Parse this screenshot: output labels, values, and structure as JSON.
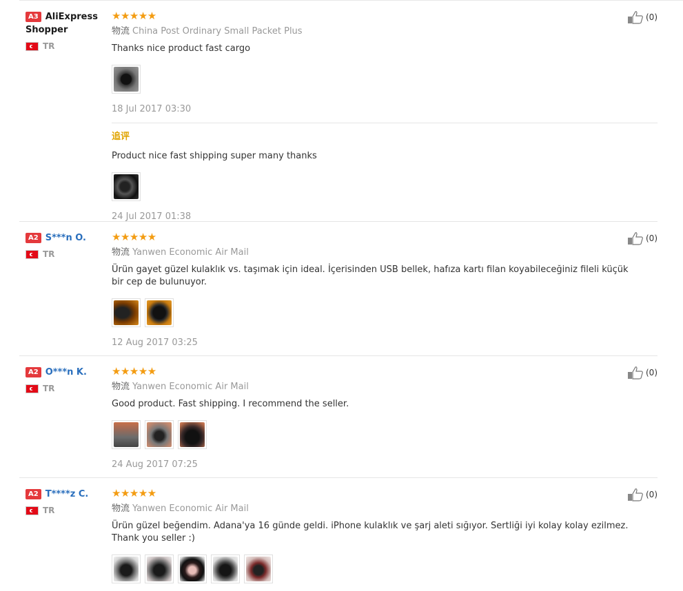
{
  "reviews": [
    {
      "level": "A3",
      "name": "AliExpress Shopper",
      "country": "TR",
      "stars": "★★★★★",
      "logistics_label": "物流",
      "logistics": "China Post Ordinary Small Packet Plus",
      "text": "Thanks nice product fast cargo",
      "date": "18 Jul 2017 03:30",
      "helpful": "(0)",
      "append_title": "追评",
      "append_text": "Product nice fast shipping super many thanks",
      "append_date": "24 Jul 2017 01:38"
    },
    {
      "level": "A2",
      "name": "S***n O.",
      "country": "TR",
      "stars": "★★★★★",
      "logistics_label": "物流",
      "logistics": "Yanwen Economic Air Mail",
      "text": "Ürün gayet güzel kulaklık vs. taşımak için ideal. İçerisinden USB bellek, hafıza kartı filan koyabileceğiniz fileli küçük bir cep de bulunuyor.",
      "date": "12 Aug 2017 03:25",
      "helpful": "(0)"
    },
    {
      "level": "A2",
      "name": "O***n K.",
      "country": "TR",
      "stars": "★★★★★",
      "logistics_label": "物流",
      "logistics": "Yanwen Economic Air Mail",
      "text": "Good product. Fast shipping. I recommend the seller.",
      "date": "24 Aug 2017 07:25",
      "helpful": "(0)"
    },
    {
      "level": "A2",
      "name": "T****z C.",
      "country": "TR",
      "stars": "★★★★★",
      "logistics_label": "物流",
      "logistics": "Yanwen Economic Air Mail",
      "text": "Ürün güzel beğendim. Adana'ya 16 günde geldi. iPhone kulaklık ve şarj aleti sığıyor. Sertliği iyi kolay kolay ezilmez. Thank you seller :)",
      "helpful": "(0)"
    }
  ],
  "colors": {
    "star": "#f39c12",
    "level_badge": "#e4393c",
    "username_link": "#2a6fbd",
    "append_title": "#e0a400"
  },
  "icons": {
    "helpful": "thumbs-up-icon",
    "flag": "turkey-flag-icon"
  }
}
